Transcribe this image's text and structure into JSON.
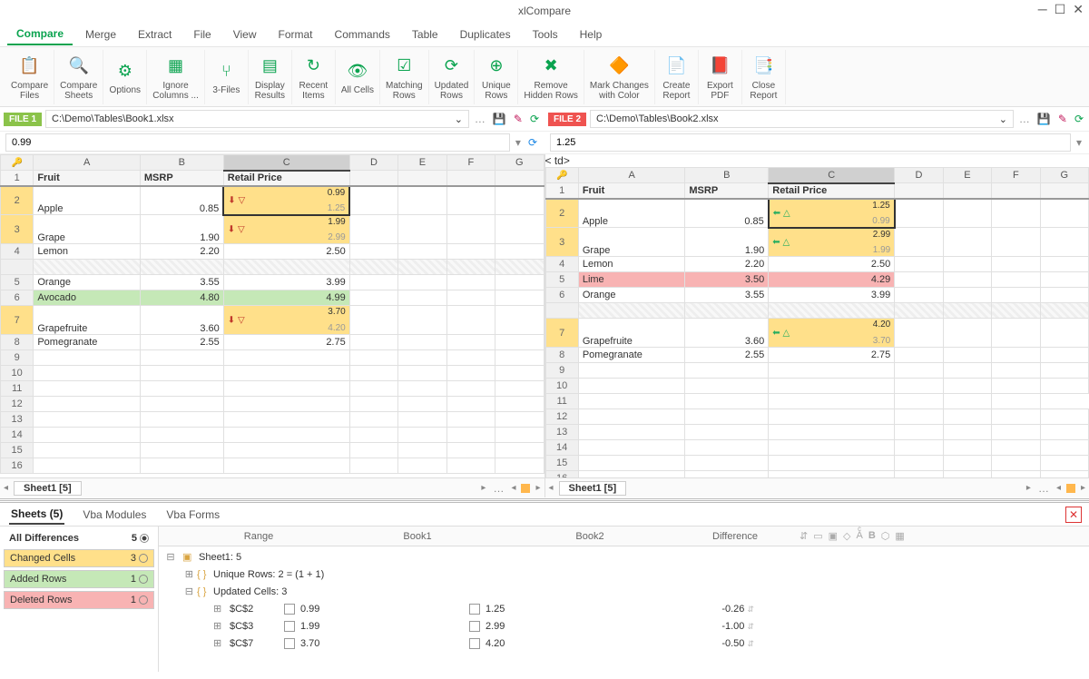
{
  "app": {
    "title": "xlCompare"
  },
  "menu": [
    "Compare",
    "Merge",
    "Extract",
    "File",
    "View",
    "Format",
    "Commands",
    "Table",
    "Duplicates",
    "Tools",
    "Help"
  ],
  "ribbon": [
    {
      "label": "Compare\nFiles",
      "icon": "📋"
    },
    {
      "label": "Compare\nSheets",
      "icon": "🔍"
    },
    {
      "label": "Options",
      "icon": "⚙"
    },
    {
      "label": "Ignore\nColumns ...",
      "icon": "▦"
    },
    {
      "label": "3-Files",
      "icon": "⑂"
    },
    {
      "label": "Display\nResults",
      "icon": "▤"
    },
    {
      "label": "Recent\nItems",
      "icon": "↻"
    },
    {
      "label": "All Cells",
      "icon": "👁"
    },
    {
      "label": "Matching\nRows",
      "icon": "☑"
    },
    {
      "label": "Updated\nRows",
      "icon": "⟳"
    },
    {
      "label": "Unique\nRows",
      "icon": "⊕"
    },
    {
      "label": "Remove\nHidden Rows",
      "icon": "✖"
    },
    {
      "label": "Mark Changes\nwith Color",
      "icon": "🔶"
    },
    {
      "label": "Create\nReport",
      "icon": "📄"
    },
    {
      "label": "Export\nPDF",
      "icon": "📕"
    },
    {
      "label": "Close\nReport",
      "icon": "📑"
    }
  ],
  "files": {
    "f1": {
      "badge": "FILE 1",
      "path": "C:\\Demo\\Tables\\Book1.xlsx",
      "formula": "0.99",
      "tab": "Sheet1 [5]"
    },
    "f2": {
      "badge": "FILE 2",
      "path": "C:\\Demo\\Tables\\Book2.xlsx",
      "formula": "1.25",
      "tab": "Sheet1 [5]"
    }
  },
  "cols": [
    "A",
    "B",
    "C",
    "D",
    "E",
    "F",
    "G"
  ],
  "headers": {
    "a": "Fruit",
    "b": "MSRP",
    "c": "Retail Price"
  },
  "grid1": {
    "r2": {
      "a": "Apple",
      "b": "0.85",
      "c1": "0.99",
      "c2": "1.25",
      "dir": "down"
    },
    "r3": {
      "a": "Grape",
      "b": "1.90",
      "c1": "1.99",
      "c2": "2.99",
      "dir": "down"
    },
    "r4": {
      "a": "Lemon",
      "b": "2.20",
      "c": "2.50"
    },
    "r5": {
      "a": "Orange",
      "b": "3.55",
      "c": "3.99"
    },
    "r6": {
      "a": "Avocado",
      "b": "4.80",
      "c": "4.99"
    },
    "r7": {
      "a": "Grapefruite",
      "b": "3.60",
      "c1": "3.70",
      "c2": "4.20",
      "dir": "down"
    },
    "r8": {
      "a": "Pomegranate",
      "b": "2.55",
      "c": "2.75"
    }
  },
  "grid2": {
    "r2": {
      "a": "Apple",
      "b": "0.85",
      "c1": "1.25",
      "c2": "0.99",
      "dir": "up"
    },
    "r3": {
      "a": "Grape",
      "b": "1.90",
      "c1": "2.99",
      "c2": "1.99",
      "dir": "up"
    },
    "r4": {
      "a": "Lemon",
      "b": "2.20",
      "c": "2.50"
    },
    "r5": {
      "a": "Lime",
      "b": "3.50",
      "c": "4.29"
    },
    "r6": {
      "a": "Orange",
      "b": "3.55",
      "c": "3.99"
    },
    "r7": {
      "a": "Grapefruite",
      "b": "3.60",
      "c1": "4.20",
      "c2": "3.70",
      "dir": "up"
    },
    "r8": {
      "a": "Pomegranate",
      "b": "2.55",
      "c": "2.75"
    }
  },
  "bottomTabs": {
    "sheets": "Sheets (5)",
    "vbaM": "Vba Modules",
    "vbaF": "Vba Forms"
  },
  "summary": {
    "all": {
      "label": "All Differences",
      "count": "5"
    },
    "changed": {
      "label": "Changed Cells",
      "count": "3"
    },
    "added": {
      "label": "Added Rows",
      "count": "1"
    },
    "deleted": {
      "label": "Deleted Rows",
      "count": "1"
    }
  },
  "detHeader": {
    "range": "Range",
    "b1": "Book1",
    "b2": "Book2",
    "diff": "Difference"
  },
  "detTree": {
    "sheet": "Sheet1: 5",
    "unique": "Unique Rows: 2 = (1 + 1)",
    "updated": "Updated Cells: 3"
  },
  "detCells": [
    {
      "ref": "$C$2",
      "v1": "0.99",
      "v2": "1.25",
      "diff": "-0.26"
    },
    {
      "ref": "$C$3",
      "v1": "1.99",
      "v2": "2.99",
      "diff": "-1.00"
    },
    {
      "ref": "$C$7",
      "v1": "3.70",
      "v2": "4.20",
      "diff": "-0.50"
    }
  ]
}
